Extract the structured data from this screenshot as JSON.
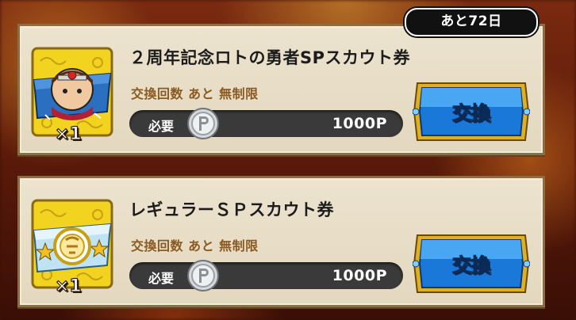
{
  "remaining_days": "あと72日",
  "items": [
    {
      "name": "２周年記念ロトの勇者SPスカウト券",
      "quantity": "×1",
      "limit_text": "交換回数 あと 無制限",
      "cost_label": "必要",
      "price": "1000P",
      "button_label": "交換",
      "icon": "hero-scout-ticket-icon"
    },
    {
      "name": "レギュラーＳＰスカウト券",
      "quantity": "×1",
      "limit_text": "交換回数 あと 無制限",
      "cost_label": "必要",
      "price": "1000P",
      "button_label": "交換",
      "icon": "regular-scout-ticket-icon"
    }
  ],
  "colors": {
    "card_bg": "#e3d8bf",
    "limit_text": "#8a5a22",
    "button_blue": "#1a78d8",
    "button_gold": "#e0b020"
  }
}
